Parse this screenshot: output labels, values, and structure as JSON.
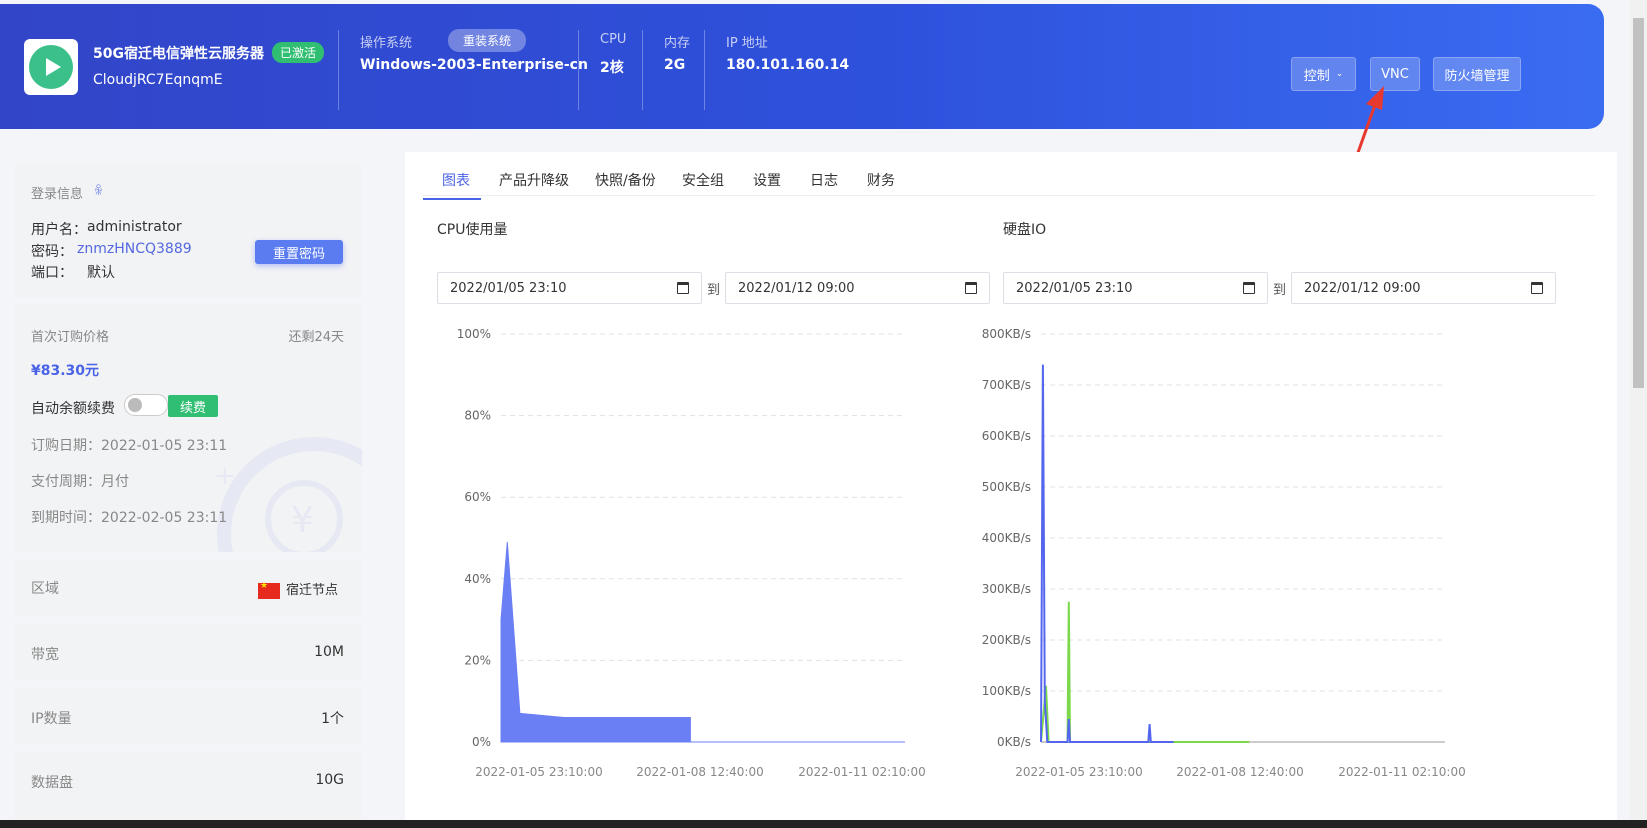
{
  "header": {
    "server_name": "50G宿迁电信弹性云服务器",
    "status_badge": "已激活",
    "server_id": "CloudjRC7EqnqmE",
    "os_label": "操作系统",
    "reinstall_label": "重装系统",
    "os_value": "Windows-2003-Enterprise-cn",
    "cpu_label": "CPU",
    "cpu_value": "2核",
    "mem_label": "内存",
    "mem_value": "2G",
    "ip_label": "IP 地址",
    "ip_value": "180.101.160.14",
    "control_label": "控制",
    "vnc_label": "VNC",
    "firewall_label": "防火墙管理"
  },
  "login": {
    "title": "登录信息",
    "username_label": "用户名：",
    "username": "administrator",
    "password_label": "密码：",
    "password": "znmzHNCQ3889",
    "port_label": "端口：",
    "port": "默认",
    "reset_label": "重置密码"
  },
  "billing": {
    "first_price_label": "首次订购价格",
    "remaining": "还剩24天",
    "price": "¥83.30元",
    "auto_renew_label": "自动余额续费",
    "renew_label": "续费",
    "order_date": "订购日期：2022-01-05 23:11",
    "pay_cycle": "支付周期：月付",
    "expire": "到期时间：2022-02-05 23:11"
  },
  "specs": [
    {
      "label": "区域",
      "value": "宿迁节点"
    },
    {
      "label": "带宽",
      "value": "10M"
    },
    {
      "label": "IP数量",
      "value": "1个"
    },
    {
      "label": "数据盘",
      "value": "10G"
    }
  ],
  "tabs": [
    "图表",
    "产品升降级",
    "快照/备份",
    "安全组",
    "设置",
    "日志",
    "财务"
  ],
  "cpu_chart": {
    "title": "CPU使用量",
    "start": "2022/01/05 23:10",
    "to": "到",
    "end": "2022/01/12 09:00"
  },
  "disk_chart": {
    "title": "硬盘IO",
    "start": "2022/01/05 23:10",
    "to": "到",
    "end": "2022/01/12 09:00"
  },
  "chart_data": [
    {
      "type": "area",
      "title": "CPU使用量",
      "y_ticks": [
        "0%",
        "20%",
        "40%",
        "60%",
        "80%",
        "100%"
      ],
      "ylim": [
        0,
        100
      ],
      "x_ticks": [
        "2022-01-05 23:10:00",
        "2022-01-08 12:40:00",
        "2022-01-11 02:10:00"
      ],
      "series": [
        {
          "color": "#6b7ff5",
          "x": [
            0,
            0.1,
            0.3,
            1.0,
            1.6,
            2.6,
            3.0,
            3.0,
            6.4
          ],
          "values": [
            30,
            49,
            7,
            6,
            6,
            6,
            6,
            0,
            0
          ]
        }
      ]
    },
    {
      "type": "line",
      "title": "硬盘IO",
      "y_ticks": [
        "0KB/s",
        "100KB/s",
        "200KB/s",
        "300KB/s",
        "400KB/s",
        "500KB/s",
        "600KB/s",
        "700KB/s",
        "800KB/s"
      ],
      "ylim": [
        0,
        800
      ],
      "x_ticks": [
        "2022-01-05 23:10:00",
        "2022-01-08 12:40:00",
        "2022-01-11 02:10:00"
      ],
      "series": [
        {
          "color": "#7ad84a",
          "x": [
            0,
            0.08,
            0.12,
            0.42,
            0.44,
            0.46,
            3.3
          ],
          "values": [
            0,
            110,
            0,
            0,
            275,
            0,
            0
          ]
        },
        {
          "color": "#5566ee",
          "x": [
            0,
            0.03,
            0.06,
            0.1,
            0.42,
            0.44,
            0.46,
            1.2,
            1.7,
            1.72,
            1.74,
            2.1
          ],
          "values": [
            0,
            740,
            80,
            0,
            0,
            45,
            0,
            0,
            0,
            35,
            0,
            0
          ]
        }
      ]
    }
  ]
}
